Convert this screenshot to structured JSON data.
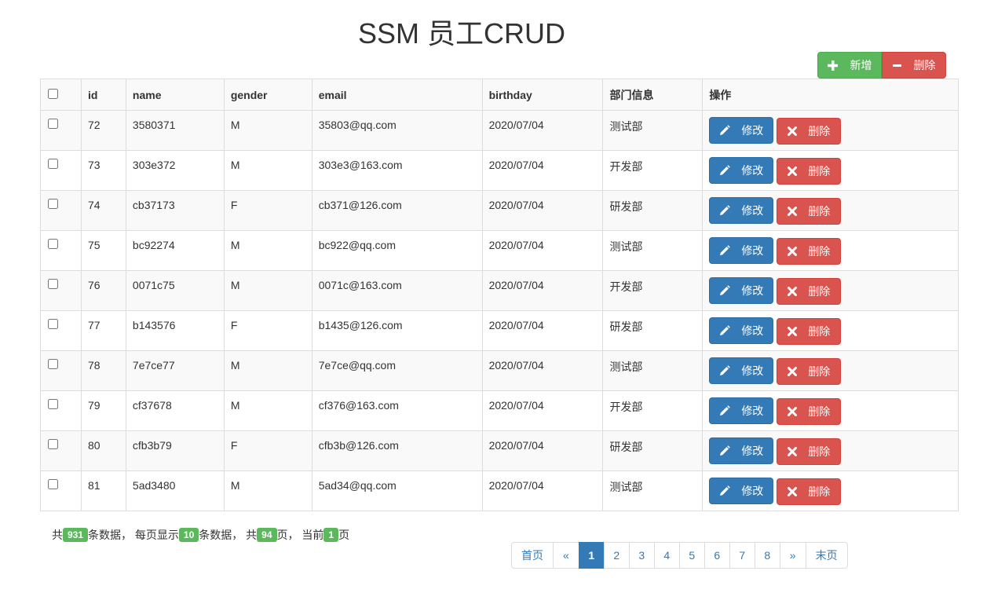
{
  "title": "SSM 员工CRUD",
  "toolbar": {
    "add_label": "新增",
    "delete_label": "删除"
  },
  "table": {
    "headers": [
      "id",
      "name",
      "gender",
      "email",
      "birthday",
      "部门信息",
      "操作"
    ],
    "edit_label": "修改",
    "delete_label": "删除",
    "rows": [
      [
        "72",
        "3580371",
        "M",
        "35803@qq.com",
        "2020/07/04",
        "测试部"
      ],
      [
        "73",
        "303e372",
        "M",
        "303e3@163.com",
        "2020/07/04",
        "开发部"
      ],
      [
        "74",
        "cb37173",
        "F",
        "cb371@126.com",
        "2020/07/04",
        "研发部"
      ],
      [
        "75",
        "bc92274",
        "M",
        "bc922@qq.com",
        "2020/07/04",
        "测试部"
      ],
      [
        "76",
        "0071c75",
        "M",
        "0071c@163.com",
        "2020/07/04",
        "开发部"
      ],
      [
        "77",
        "b143576",
        "F",
        "b1435@126.com",
        "2020/07/04",
        "研发部"
      ],
      [
        "78",
        "7e7ce77",
        "M",
        "7e7ce@qq.com",
        "2020/07/04",
        "测试部"
      ],
      [
        "79",
        "cf37678",
        "M",
        "cf376@163.com",
        "2020/07/04",
        "开发部"
      ],
      [
        "80",
        "cfb3b79",
        "F",
        "cfb3b@126.com",
        "2020/07/04",
        "研发部"
      ],
      [
        "81",
        "5ad3480",
        "M",
        "5ad34@qq.com",
        "2020/07/04",
        "测试部"
      ]
    ]
  },
  "pageinfo": {
    "t1": "共",
    "total": "931",
    "t2": "条数据， 每页显示",
    "per_page": "10",
    "t3": "条数据， 共",
    "pages": "94",
    "t4": "页， 当前",
    "current": "1",
    "t5": "页"
  },
  "pagination": {
    "first": "首页",
    "prev": "«",
    "pages": [
      "1",
      "2",
      "3",
      "4",
      "5",
      "6",
      "7",
      "8"
    ],
    "next": "»",
    "last": "末页",
    "active": "1"
  },
  "colors": {
    "success": "#5cb85c",
    "danger": "#d9534f",
    "primary": "#337ab7"
  }
}
